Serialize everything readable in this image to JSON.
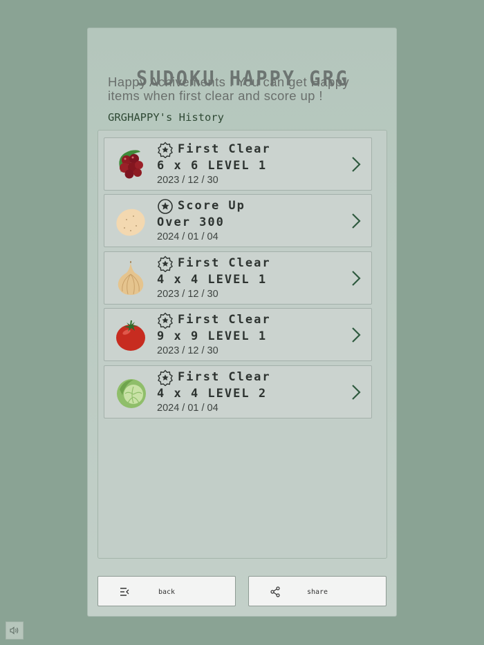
{
  "header": {
    "title": "SUDOKU HAPPY GRG"
  },
  "intro": {
    "text": "Happy Achivements ! You can get Happy items when first clear and score up !"
  },
  "history": {
    "label": "GRGHAPPY's History"
  },
  "achievements": [
    {
      "icon": "grapes-icon",
      "badge": "star-seal-badge",
      "title": "First Clear",
      "detail": "6 x 6 LEVEL 1",
      "date": "2023 / 12 / 30"
    },
    {
      "icon": "potato-icon",
      "badge": "star-circle-badge",
      "title": "Score Up",
      "detail": "Over 300",
      "date": "2024 / 01 / 04"
    },
    {
      "icon": "onion-icon",
      "badge": "star-seal-badge",
      "title": "First Clear",
      "detail": "4 x 4 LEVEL 1",
      "date": "2023 / 12 / 30"
    },
    {
      "icon": "tomato-icon",
      "badge": "star-seal-badge",
      "title": "First Clear",
      "detail": "9 x 9 LEVEL 1",
      "date": "2023 / 12 / 30"
    },
    {
      "icon": "cabbage-icon",
      "badge": "star-seal-badge",
      "title": "First Clear",
      "detail": "4 x 4 LEVEL 2",
      "date": "2024 / 01 / 04"
    }
  ],
  "footer": {
    "back_label": "back",
    "share_label": "share"
  },
  "colors": {
    "background": "#8aa394",
    "panel": "#b4c6bc",
    "accent": "#2f5a3f",
    "text": "#2d3330"
  }
}
